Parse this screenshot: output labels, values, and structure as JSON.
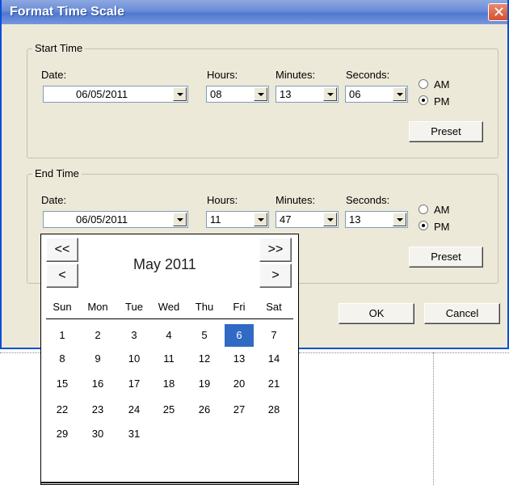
{
  "window": {
    "title": "Format Time Scale",
    "close_glyph": "✕"
  },
  "start": {
    "legend": "Start Time",
    "date_label": "Date:",
    "date_value": "06/05/2011",
    "hours_label": "Hours:",
    "hours_value": "08",
    "minutes_label": "Minutes:",
    "minutes_value": "13",
    "seconds_label": "Seconds:",
    "seconds_value": "06",
    "am_label": "AM",
    "pm_label": "PM",
    "selected_period": "PM",
    "preset_label": "Preset"
  },
  "end": {
    "legend": "End Time",
    "date_label": "Date:",
    "date_value": "06/05/2011",
    "hours_label": "Hours:",
    "hours_value": "11",
    "minutes_label": "Minutes:",
    "minutes_value": "47",
    "seconds_label": "Seconds:",
    "seconds_value": "13",
    "am_label": "AM",
    "pm_label": "PM",
    "selected_period": "PM",
    "preset_label": "Preset"
  },
  "buttons": {
    "ok": "OK",
    "cancel": "Cancel"
  },
  "calendar": {
    "prev_year": "<<",
    "prev_month": "<",
    "next_year": ">>",
    "next_month": ">",
    "month_label": "May 2011",
    "weekdays": [
      "Sun",
      "Mon",
      "Tue",
      "Wed",
      "Thu",
      "Fri",
      "Sat"
    ],
    "weeks": [
      [
        "1",
        "2",
        "3",
        "4",
        "5",
        "6",
        "7"
      ],
      [
        "8",
        "9",
        "10",
        "11",
        "12",
        "13",
        "14"
      ],
      [
        "15",
        "16",
        "17",
        "18",
        "19",
        "20",
        "21"
      ],
      [
        "22",
        "23",
        "24",
        "25",
        "26",
        "27",
        "28"
      ],
      [
        "29",
        "30",
        "31",
        "",
        "",
        "",
        ""
      ]
    ],
    "selected_day": "6",
    "selection_color": "#316ac5"
  }
}
